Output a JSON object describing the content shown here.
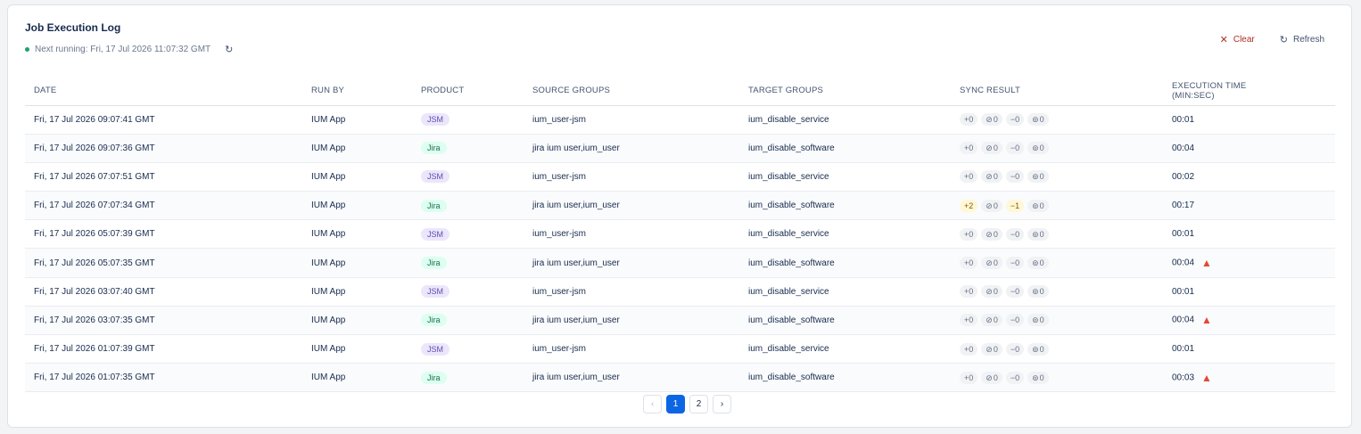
{
  "header": {
    "title": "Job Execution Log",
    "next_running": "Next running: Fri, 17 Jul 2026 11:07:32 GMT",
    "clear_label": "Clear",
    "refresh_label": "Refresh"
  },
  "columns": {
    "date": "DATE",
    "run_by": "RUN BY",
    "product": "PRODUCT",
    "source_groups": "SOURCE GROUPS",
    "target_groups": "TARGET GROUPS",
    "sync_result": "SYNC RESULT",
    "execution_time_line1": "EXECUTION TIME",
    "execution_time_line2": "(MIN:SEC)"
  },
  "rows": [
    {
      "date": "Fri, 17 Jul 2026 09:07:41 GMT",
      "run_by": "IUM App",
      "product": "JSM",
      "source": "ium_user-jsm",
      "target": "ium_disable_service",
      "added": "+0",
      "skipped": "0",
      "removed": "−0",
      "linked": "0",
      "time": "00:01",
      "warning": false
    },
    {
      "date": "Fri, 17 Jul 2026 09:07:36 GMT",
      "run_by": "IUM App",
      "product": "Jira",
      "source": "jira ium user,ium_user",
      "target": "ium_disable_software",
      "added": "+0",
      "skipped": "0",
      "removed": "−0",
      "linked": "0",
      "time": "00:04",
      "warning": false
    },
    {
      "date": "Fri, 17 Jul 2026 07:07:51 GMT",
      "run_by": "IUM App",
      "product": "JSM",
      "source": "ium_user-jsm",
      "target": "ium_disable_service",
      "added": "+0",
      "skipped": "0",
      "removed": "−0",
      "linked": "0",
      "time": "00:02",
      "warning": false
    },
    {
      "date": "Fri, 17 Jul 2026 07:07:34 GMT",
      "run_by": "IUM App",
      "product": "Jira",
      "source": "jira ium user,ium_user",
      "target": "ium_disable_software",
      "added": "+2",
      "skipped": "0",
      "removed": "−1",
      "linked": "0",
      "time": "00:17",
      "warning": false
    },
    {
      "date": "Fri, 17 Jul 2026 05:07:39 GMT",
      "run_by": "IUM App",
      "product": "JSM",
      "source": "ium_user-jsm",
      "target": "ium_disable_service",
      "added": "+0",
      "skipped": "0",
      "removed": "−0",
      "linked": "0",
      "time": "00:01",
      "warning": false
    },
    {
      "date": "Fri, 17 Jul 2026 05:07:35 GMT",
      "run_by": "IUM App",
      "product": "Jira",
      "source": "jira ium user,ium_user",
      "target": "ium_disable_software",
      "added": "+0",
      "skipped": "0",
      "removed": "−0",
      "linked": "0",
      "time": "00:04",
      "warning": true
    },
    {
      "date": "Fri, 17 Jul 2026 03:07:40 GMT",
      "run_by": "IUM App",
      "product": "JSM",
      "source": "ium_user-jsm",
      "target": "ium_disable_service",
      "added": "+0",
      "skipped": "0",
      "removed": "−0",
      "linked": "0",
      "time": "00:01",
      "warning": false
    },
    {
      "date": "Fri, 17 Jul 2026 03:07:35 GMT",
      "run_by": "IUM App",
      "product": "Jira",
      "source": "jira ium user,ium_user",
      "target": "ium_disable_software",
      "added": "+0",
      "skipped": "0",
      "removed": "−0",
      "linked": "0",
      "time": "00:04",
      "warning": true
    },
    {
      "date": "Fri, 17 Jul 2026 01:07:39 GMT",
      "run_by": "IUM App",
      "product": "JSM",
      "source": "ium_user-jsm",
      "target": "ium_disable_service",
      "added": "+0",
      "skipped": "0",
      "removed": "−0",
      "linked": "0",
      "time": "00:01",
      "warning": false
    },
    {
      "date": "Fri, 17 Jul 2026 01:07:35 GMT",
      "run_by": "IUM App",
      "product": "Jira",
      "source": "jira ium user,ium_user",
      "target": "ium_disable_software",
      "added": "+0",
      "skipped": "0",
      "removed": "−0",
      "linked": "0",
      "time": "00:03",
      "warning": true
    }
  ],
  "pagination": {
    "prev": "‹",
    "pages": [
      "1",
      "2"
    ],
    "current": "1",
    "next": "›"
  },
  "colors": {
    "accent": "#0c66e4",
    "danger": "#ae2e24",
    "warning_icon": "#e34935",
    "status_dot": "#22a06b"
  },
  "icons": {
    "clear": "close-icon",
    "refresh": "refresh-icon",
    "warning": "warning-triangle-icon",
    "skipped": "block-icon",
    "linked": "link-icon"
  }
}
